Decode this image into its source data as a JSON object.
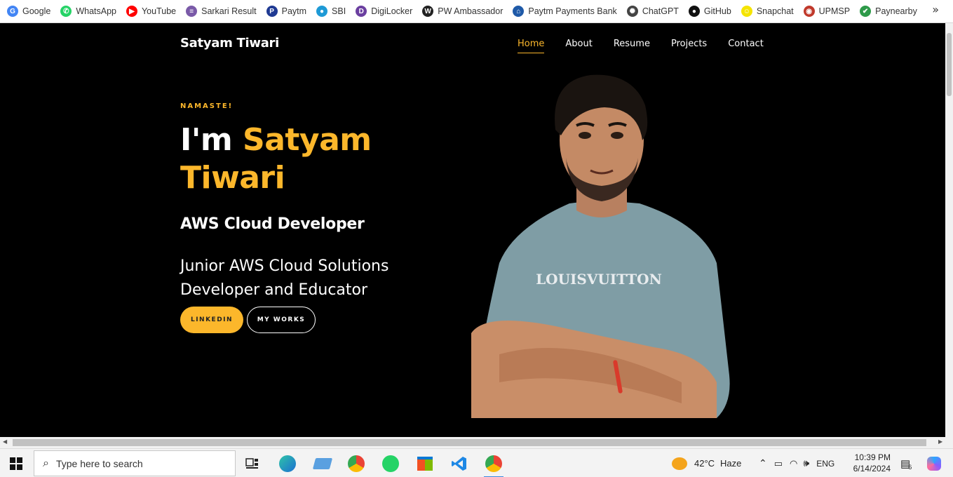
{
  "bookmarks": [
    {
      "label": "Google",
      "icon": "google-icon",
      "color": "#4285f4",
      "glyph": "G"
    },
    {
      "label": "WhatsApp",
      "icon": "whatsapp-icon",
      "color": "#25d366",
      "glyph": "✆"
    },
    {
      "label": "YouTube",
      "icon": "youtube-icon",
      "color": "#ff0000",
      "glyph": "▶"
    },
    {
      "label": "Sarkari Result",
      "icon": "sarkari-result-icon",
      "color": "#7a5aa8",
      "glyph": "≡"
    },
    {
      "label": "Paytm",
      "icon": "paytm-icon",
      "color": "#1f3a93",
      "glyph": "P"
    },
    {
      "label": "SBI",
      "icon": "sbi-icon",
      "color": "#1e9ad6",
      "glyph": "●"
    },
    {
      "label": "DigiLocker",
      "icon": "digilocker-icon",
      "color": "#6b3fa0",
      "glyph": "D"
    },
    {
      "label": "PW Ambassador",
      "icon": "pw-ambassador-icon",
      "color": "#222222",
      "glyph": "W"
    },
    {
      "label": "Paytm Payments Bank",
      "icon": "paytm-payments-bank-icon",
      "color": "#1f5aa8",
      "glyph": "⌂"
    },
    {
      "label": "ChatGPT",
      "icon": "chatgpt-icon",
      "color": "#444444",
      "glyph": "✺"
    },
    {
      "label": "GitHub",
      "icon": "github-icon",
      "color": "#111111",
      "glyph": "●"
    },
    {
      "label": "Snapchat",
      "icon": "snapchat-icon",
      "color": "#f5e400",
      "glyph": "☺"
    },
    {
      "label": "UPMSP",
      "icon": "upmsp-icon",
      "color": "#c0392b",
      "glyph": "◉"
    },
    {
      "label": "Paynearby",
      "icon": "paynearby-icon",
      "color": "#2e9a4a",
      "glyph": "✔"
    }
  ],
  "bookmarks_more": "»",
  "site": {
    "brand": "Satyam Tiwari",
    "nav": [
      "Home",
      "About",
      "Resume",
      "Projects",
      "Contact"
    ],
    "active_nav": "Home",
    "greeting": "NAMASTE!",
    "title_prefix": "I'm ",
    "title_name": "Satyam Tiwari",
    "role": "AWS Cloud Developer",
    "description": "Junior AWS Cloud Solutions Developer and Educator",
    "buttons": {
      "primary": "LINKEDIN",
      "secondary": "MY WORKS"
    },
    "accent_color": "#fcb72b"
  },
  "taskbar": {
    "search_placeholder": "Type here to search",
    "weather": {
      "temp": "42°C",
      "condition": "Haze"
    },
    "language": "ENG",
    "time": "10:39 PM",
    "date": "6/14/2024",
    "notification_count": "6"
  }
}
